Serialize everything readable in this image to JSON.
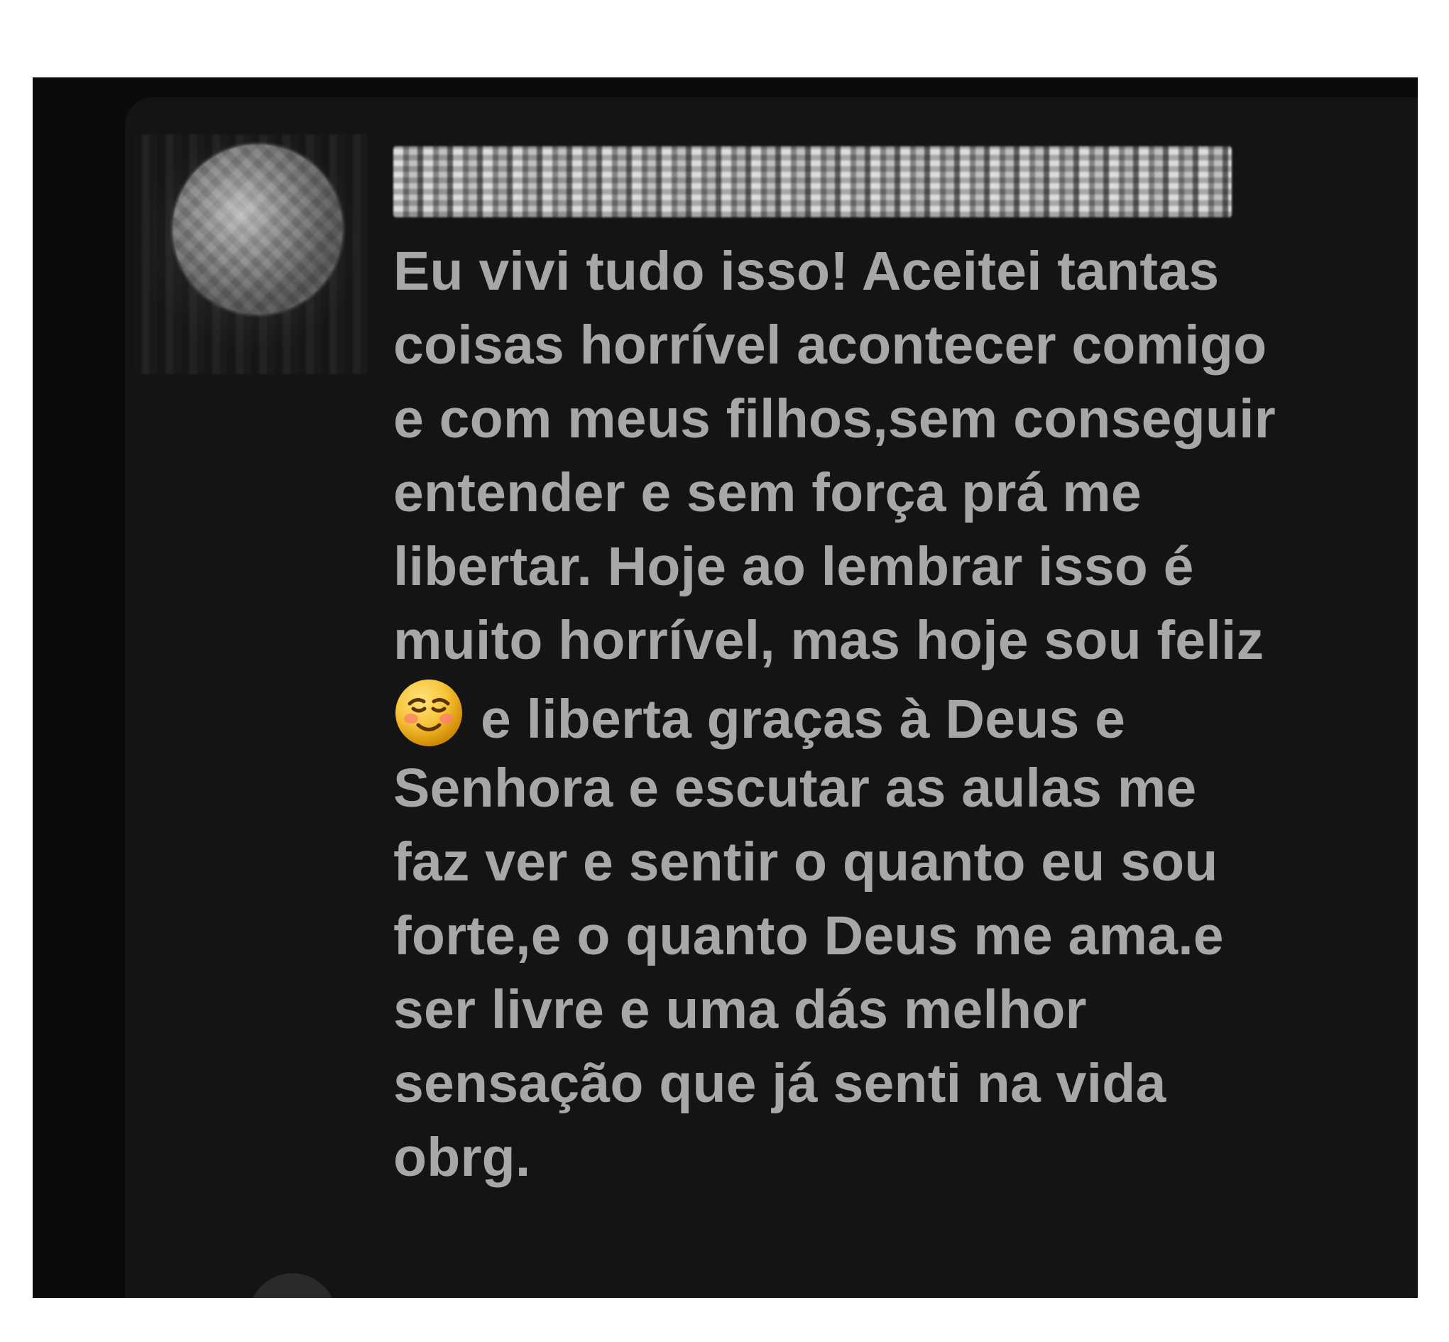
{
  "comment": {
    "author_redacted": "",
    "lines": [
      "Eu vivi tudo isso! Aceitei tantas",
      "coisas horrível acontecer comigo",
      "e com meus filhos,sem conseguir",
      "entender e sem força prá me",
      "libertar. Hoje ao lembrar isso é",
      "muito horrível, mas hoje sou feliz",
      "e liberta graças à Deus e",
      "Senhora e escutar as aulas me",
      "faz ver e sentir o quanto eu sou",
      "forte,e o quanto Deus me ama.e",
      "ser livre e uma dás melhor",
      "sensação que já senti na vida",
      "obrg."
    ],
    "emoji_name": "smiling-face-icon"
  },
  "colors": {
    "page_background": "#ffffff",
    "frame_background": "#0b0b0b",
    "card_background": "#141414",
    "text": "#a7a7a7",
    "emoji_face": "#f4b400"
  }
}
